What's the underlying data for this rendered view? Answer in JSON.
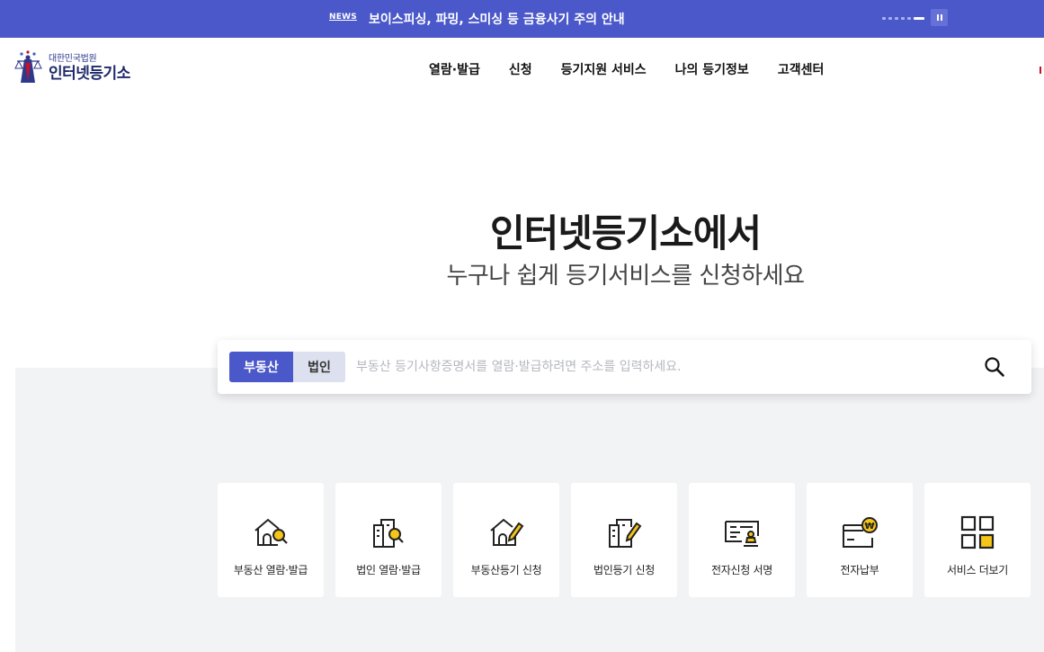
{
  "news": {
    "tag": "NEWS",
    "text": "보이스피싱, 파밍, 스미싱 등 금융사기 주의 안내",
    "dots_total": 6,
    "dots_active_index": 5
  },
  "header": {
    "logo_sub": "대한민국법원",
    "logo_main": "인터넷등기소",
    "nav": [
      "열람·발급",
      "신청",
      "등기지원 서비스",
      "나의 등기정보",
      "고객센터"
    ]
  },
  "hero": {
    "title": "인터넷등기소에서",
    "subtitle": "누구나 쉽게 등기서비스를 신청하세요"
  },
  "search": {
    "tab_active": "부동산",
    "tab_inactive": "법인",
    "placeholder": "부동산 등기사항증명서를 열람·발급하려면 주소를 입력하세요."
  },
  "services": [
    {
      "label": "부동산 열람·발급",
      "icon": "house-search-icon"
    },
    {
      "label": "법인 열람·발급",
      "icon": "building-search-icon"
    },
    {
      "label": "부동산등기 신청",
      "icon": "house-pen-icon"
    },
    {
      "label": "법인등기 신청",
      "icon": "building-pen-icon"
    },
    {
      "label": "전자신청 서명",
      "icon": "document-stamp-icon"
    },
    {
      "label": "전자납부",
      "icon": "card-won-icon"
    },
    {
      "label": "서비스 더보기",
      "icon": "grid-more-icon"
    }
  ],
  "colors": {
    "brand": "#4a58c9",
    "accent_yellow": "#f5c518",
    "gray_bg": "#f2f3f5"
  }
}
